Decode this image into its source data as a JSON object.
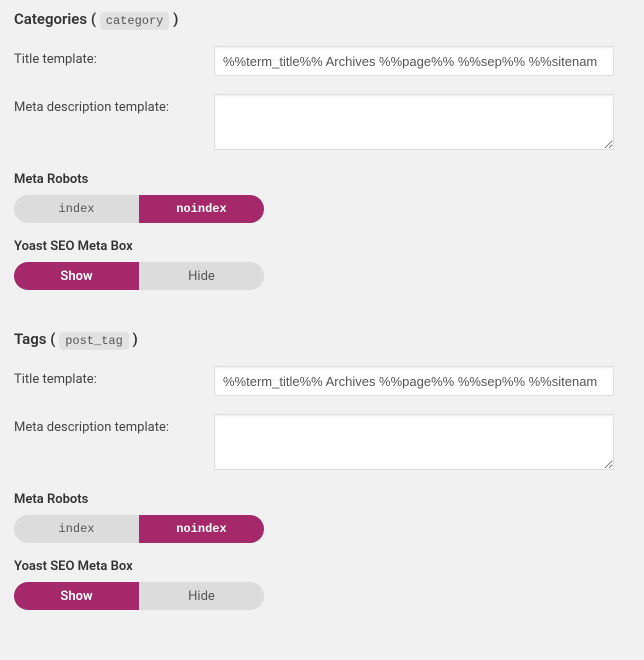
{
  "sections": [
    {
      "heading": "Categories",
      "code": "category",
      "title_template_label": "Title template:",
      "title_template_value": "%%term_title%% Archives %%page%% %%sep%% %%sitenam",
      "meta_desc_label": "Meta description template:",
      "meta_desc_value": "",
      "meta_robots_label": "Meta Robots",
      "meta_robots_index": "index",
      "meta_robots_noindex": "noindex",
      "meta_box_label": "Yoast SEO Meta Box",
      "meta_box_show": "Show",
      "meta_box_hide": "Hide"
    },
    {
      "heading": "Tags",
      "code": "post_tag",
      "title_template_label": "Title template:",
      "title_template_value": "%%term_title%% Archives %%page%% %%sep%% %%sitenam",
      "meta_desc_label": "Meta description template:",
      "meta_desc_value": "",
      "meta_robots_label": "Meta Robots",
      "meta_robots_index": "index",
      "meta_robots_noindex": "noindex",
      "meta_box_label": "Yoast SEO Meta Box",
      "meta_box_show": "Show",
      "meta_box_hide": "Hide"
    }
  ]
}
